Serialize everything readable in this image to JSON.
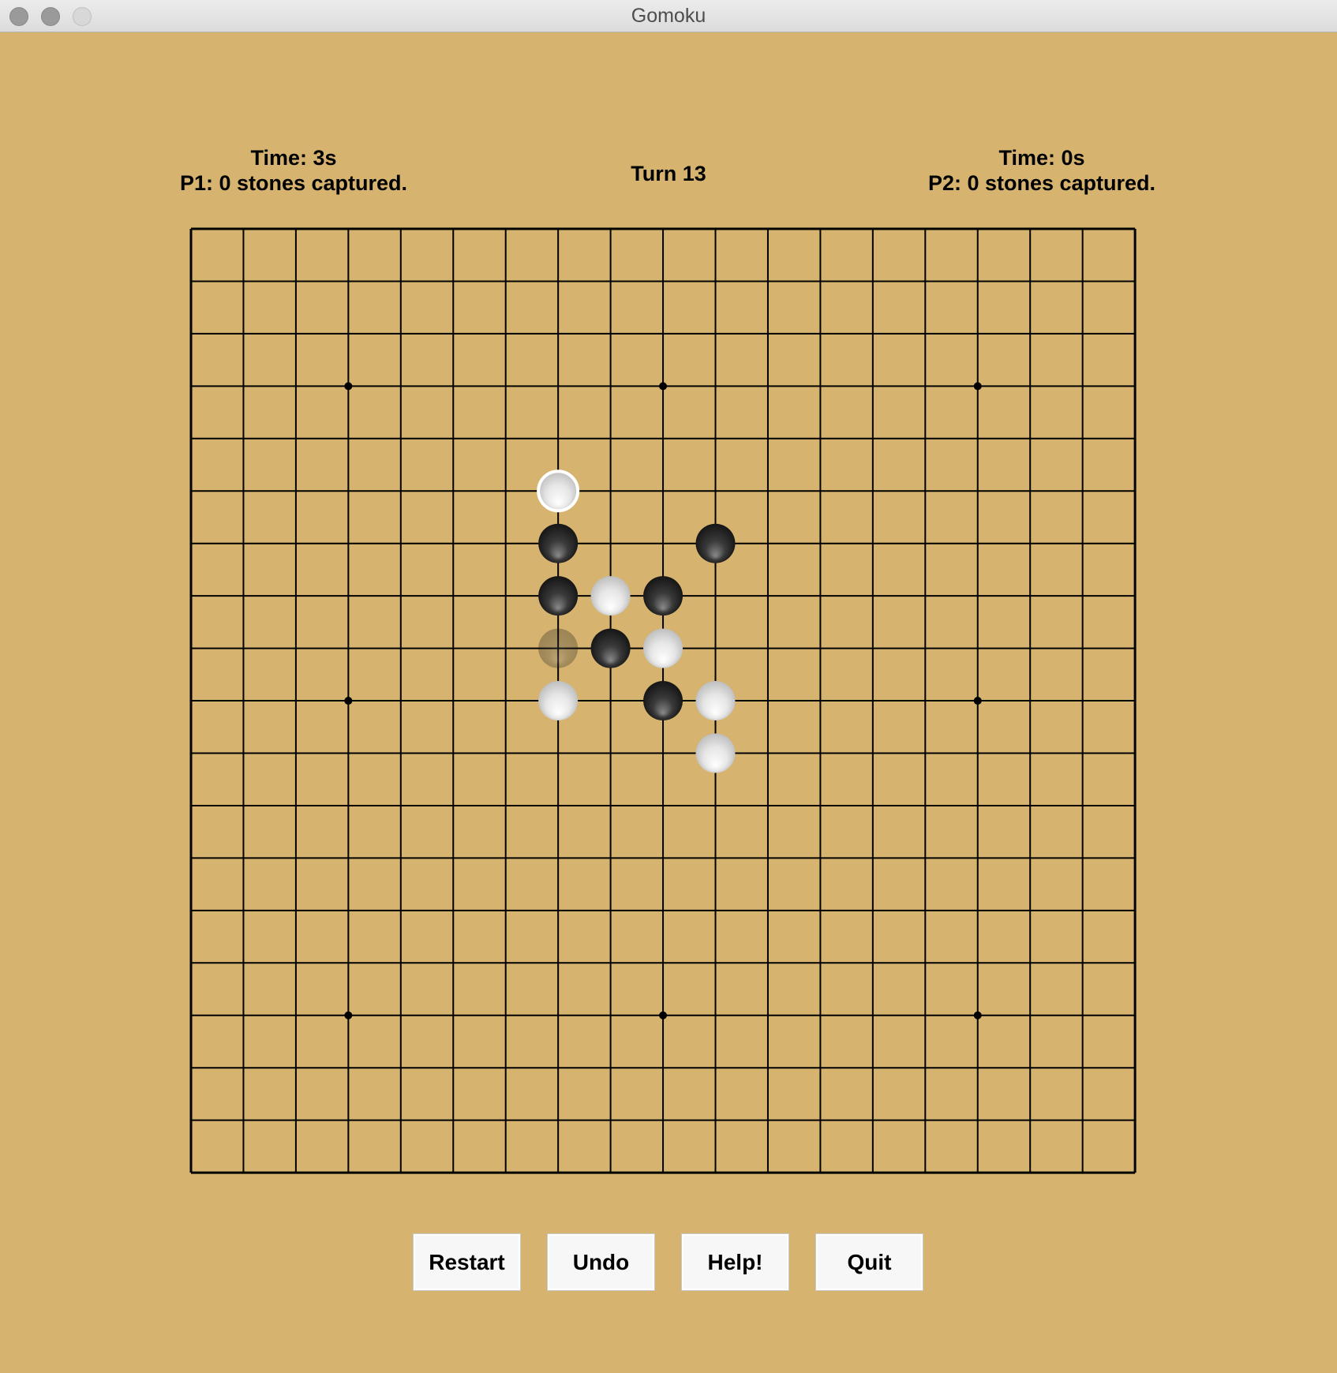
{
  "window": {
    "title": "Gomoku",
    "controls": [
      "close-icon",
      "minimize-icon",
      "zoom-icon"
    ]
  },
  "players": {
    "p1": {
      "time_label": "Time: 3s",
      "captured_label": "P1: 0 stones captured."
    },
    "p2": {
      "time_label": "Time: 0s",
      "captured_label": "P2: 0 stones captured."
    }
  },
  "turn_label": "Turn 13",
  "board": {
    "size": 19,
    "background": "#d6b36f",
    "line_color": "#000000",
    "star_points": [
      [
        3,
        3
      ],
      [
        9,
        3
      ],
      [
        15,
        3
      ],
      [
        3,
        9
      ],
      [
        15,
        9
      ],
      [
        3,
        15
      ],
      [
        9,
        15
      ],
      [
        15,
        15
      ]
    ],
    "stones": [
      {
        "col": 7,
        "row": 5,
        "color": "white",
        "last_move": true
      },
      {
        "col": 7,
        "row": 6,
        "color": "black"
      },
      {
        "col": 10,
        "row": 6,
        "color": "black"
      },
      {
        "col": 7,
        "row": 7,
        "color": "black"
      },
      {
        "col": 8,
        "row": 7,
        "color": "white"
      },
      {
        "col": 9,
        "row": 7,
        "color": "black"
      },
      {
        "col": 7,
        "row": 8,
        "color": "black",
        "ghost": true
      },
      {
        "col": 8,
        "row": 8,
        "color": "black"
      },
      {
        "col": 9,
        "row": 8,
        "color": "white"
      },
      {
        "col": 7,
        "row": 9,
        "color": "white"
      },
      {
        "col": 9,
        "row": 9,
        "color": "black"
      },
      {
        "col": 10,
        "row": 9,
        "color": "white"
      },
      {
        "col": 10,
        "row": 10,
        "color": "white"
      }
    ]
  },
  "buttons": {
    "restart": "Restart",
    "undo": "Undo",
    "help": "Help!",
    "quit": "Quit"
  },
  "colors": {
    "wood": "#d6b36f",
    "black_stone": "#1a1a1a",
    "white_stone": "#f2f2f2"
  }
}
